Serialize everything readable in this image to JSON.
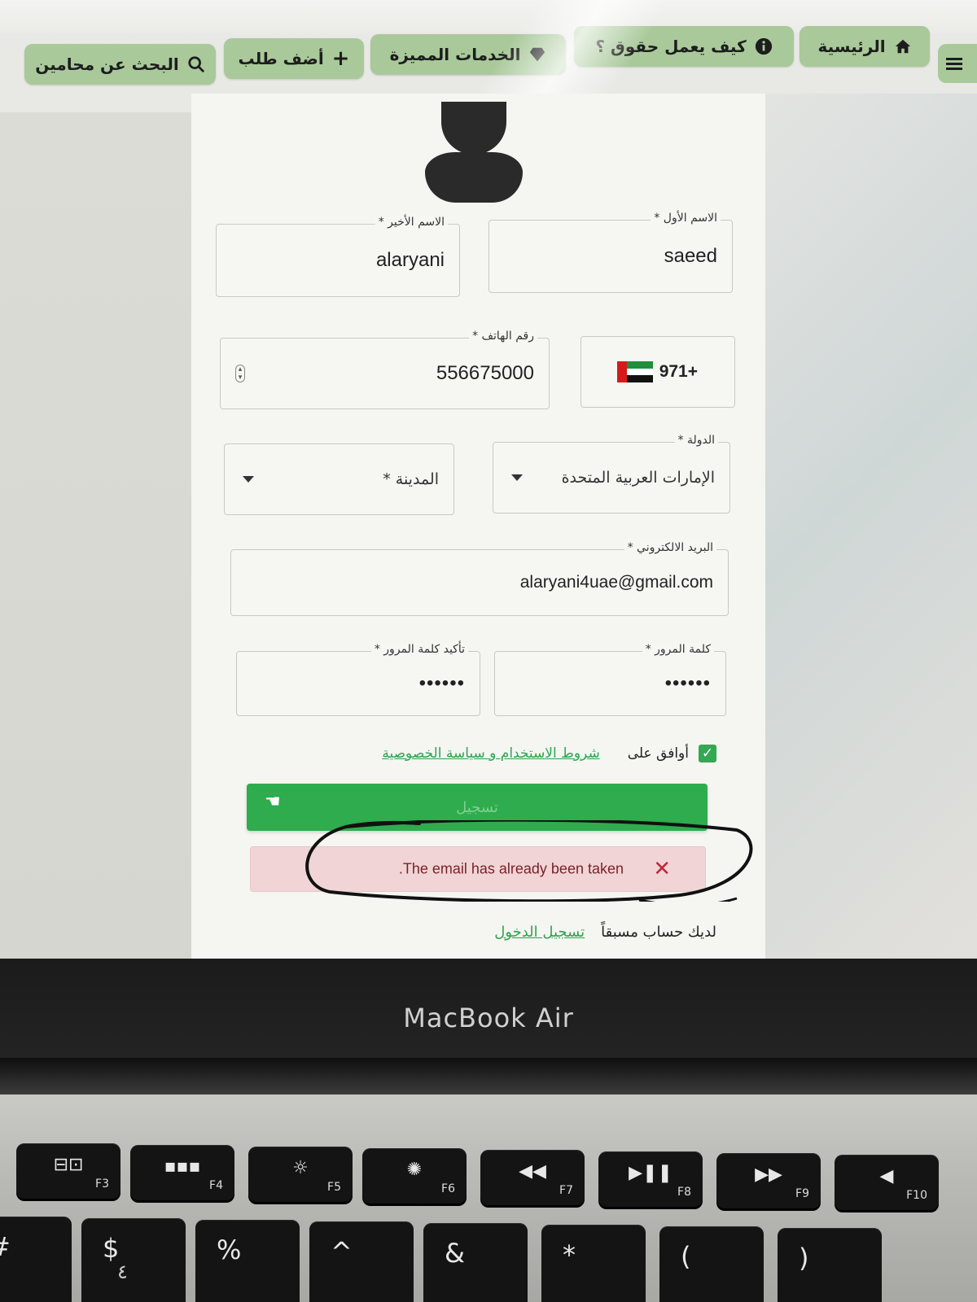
{
  "nav": {
    "home": "الرئيسية",
    "how_it_works": "كيف يعمل حقوق ؟",
    "featured_services": "الخدمات المميزة",
    "add_request": "أضف طلب",
    "search_lawyers": "البحث عن محامين"
  },
  "form": {
    "first_name": {
      "label": "الاسم الأول *",
      "value": "saeed"
    },
    "last_name": {
      "label": "الاسم الأخير *",
      "value": "alaryani"
    },
    "phone": {
      "label": "رقم الهاتف *",
      "country_code": "971+",
      "value": "556675000"
    },
    "country": {
      "label": "الدولة *",
      "value": "الإمارات العربية المتحدة"
    },
    "city": {
      "placeholder": "المدينة *"
    },
    "email": {
      "label": "البريد الالكتروني *",
      "value": "alaryani4uae@gmail.com"
    },
    "password": {
      "label": "كلمة المرور *",
      "value": "••••••"
    },
    "confirm_password": {
      "label": "تأكيد كلمة المرور *",
      "value": "••••••"
    },
    "agree_text": "أوافق على",
    "terms_link": "شروط الاستخدام و سياسة الخصوصية",
    "agree_checked": true,
    "submit_label": "تسجيل",
    "error_message": ".The email has already been taken",
    "error_close": "✕",
    "have_account_text": "لديك حساب مسبقاً",
    "login_link": "تسجيل الدخول"
  },
  "laptop": {
    "brand": "MacBook Air",
    "fkeys": [
      {
        "glyph": "⊟⊡",
        "label": "F3"
      },
      {
        "glyph": "▪▪▪",
        "label": "F4"
      },
      {
        "glyph": "☼",
        "label": "F5"
      },
      {
        "glyph": "✺",
        "label": "F6"
      },
      {
        "glyph": "◀◀",
        "label": "F7"
      },
      {
        "glyph": "▶❚❚",
        "label": "F8"
      },
      {
        "glyph": "▶▶",
        "label": "F9"
      },
      {
        "glyph": "◀",
        "label": "F10"
      }
    ],
    "numkeys": [
      {
        "sym": "#",
        "sub": ""
      },
      {
        "sym": "$",
        "sub": "٤"
      },
      {
        "sym": "%",
        "sub": ""
      },
      {
        "sym": "^",
        "sub": ""
      },
      {
        "sym": "&",
        "sub": ""
      },
      {
        "sym": "*",
        "sub": ""
      },
      {
        "sym": "(",
        "sub": ""
      },
      {
        "sym": ")",
        "sub": ""
      }
    ]
  },
  "colors": {
    "nav_bg": "#a9c99a",
    "submit_green": "#2eac4e",
    "link_green": "#2ea44f",
    "error_bg": "#f1d5d6",
    "error_text": "#7a1f2a"
  }
}
